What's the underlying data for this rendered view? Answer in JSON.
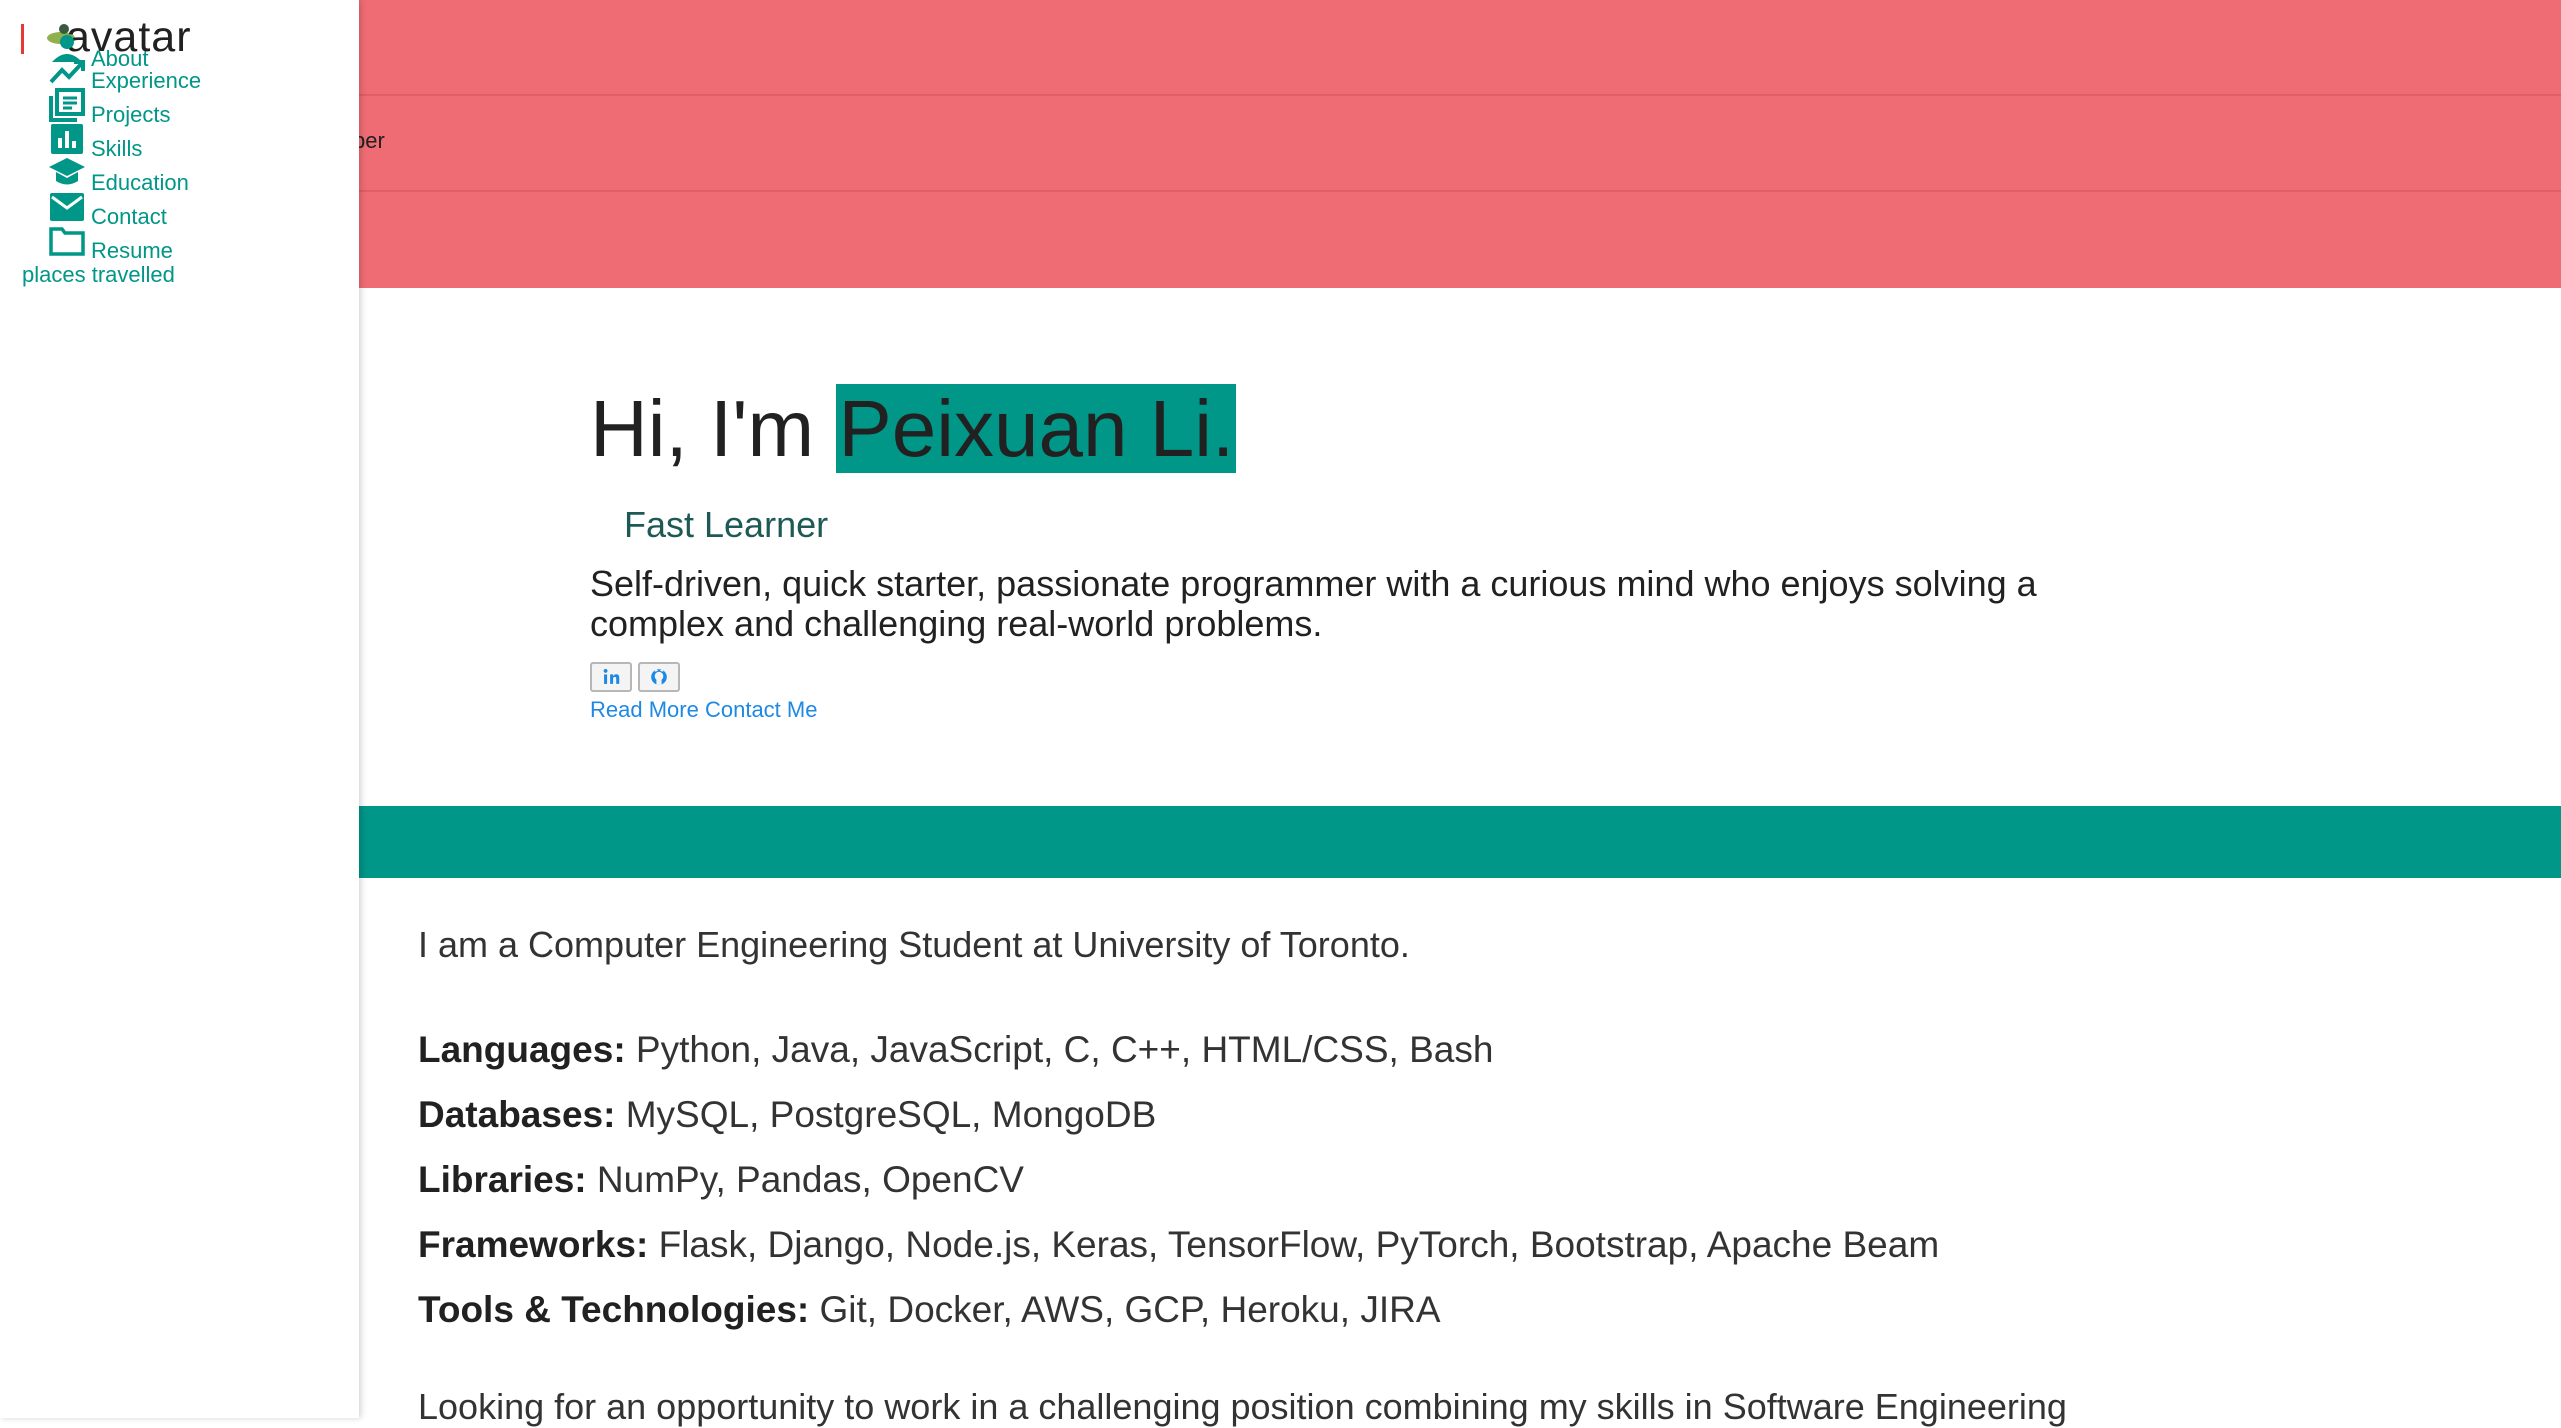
{
  "sidebar": {
    "avatar_text": "avatar",
    "items": [
      {
        "label": "About",
        "icon": "person-icon"
      },
      {
        "label": "Experience",
        "icon": "trending-up-icon"
      },
      {
        "label": "Projects",
        "icon": "document-list-icon"
      },
      {
        "label": "Skills",
        "icon": "bar-chart-icon"
      },
      {
        "label": "Education",
        "icon": "graduation-cap-icon"
      },
      {
        "label": "Contact",
        "icon": "mail-icon"
      },
      {
        "label": "Resume",
        "icon": "folder-icon"
      }
    ],
    "places_travelled": "places travelled"
  },
  "header": {
    "truncated_text": "ber"
  },
  "hero": {
    "greeting": "Hi, I'm ",
    "name": "Peixuan Li.",
    "subtitle": "Fast Learner",
    "description": "Self-driven, quick starter, passionate programmer with a curious mind who enjoys solving a complex and challenging real-world problems.",
    "social": [
      {
        "name": "linkedin",
        "icon": "linkedin-icon"
      },
      {
        "name": "github",
        "icon": "github-icon"
      }
    ],
    "read_more": "Read More",
    "contact_me": "Contact Me"
  },
  "about": {
    "intro": "I am a Computer Engineering Student at University of Toronto.",
    "skills": [
      {
        "label": "Languages:",
        "value": "Python, Java, JavaScript, C, C++, HTML/CSS, Bash"
      },
      {
        "label": "Databases:",
        "value": "MySQL, PostgreSQL, MongoDB"
      },
      {
        "label": "Libraries:",
        "value": "NumPy, Pandas, OpenCV"
      },
      {
        "label": "Frameworks:",
        "value": "Flask, Django, Node.js, Keras, TensorFlow, PyTorch, Bootstrap, Apache Beam"
      },
      {
        "label": "Tools & Technologies:",
        "value": "Git, Docker, AWS, GCP, Heroku, JIRA"
      }
    ],
    "looking": "Looking for an opportunity to work in a challenging position combining my skills in Software Engineering"
  },
  "colors": {
    "accent": "#009688",
    "header_bg": "#ef6c74",
    "link": "#1e88e5"
  }
}
